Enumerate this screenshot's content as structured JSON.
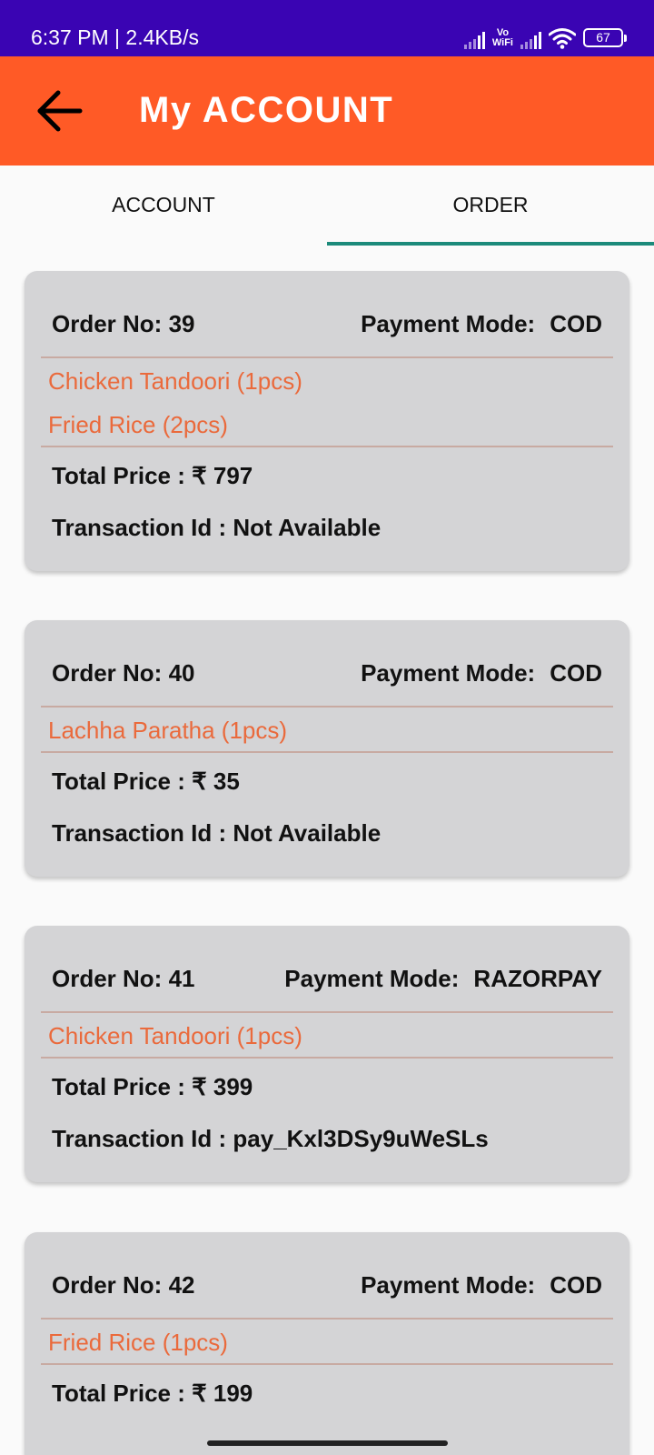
{
  "status_bar": {
    "time_speed": "6:37 PM | 2.4KB/s",
    "vowifi_top": "Vo",
    "vowifi_bottom": "WiFi",
    "battery": "67"
  },
  "app_bar": {
    "title": "My ACCOUNT",
    "back_icon": "arrow-left-icon"
  },
  "tabs": [
    {
      "label": "ACCOUNT",
      "selected": false
    },
    {
      "label": "ORDER",
      "selected": true
    }
  ],
  "labels": {
    "order_no": "Order No:",
    "payment_mode": "Payment Mode:",
    "total_price": "Total Price :",
    "transaction_id": "Transaction Id :"
  },
  "orders": [
    {
      "order_no": "39",
      "payment_mode": "COD",
      "items": [
        "Chicken Tandoori (1pcs)",
        "Fried Rice (2pcs)"
      ],
      "total_price": "₹ 797",
      "transaction_id": "Not Available"
    },
    {
      "order_no": "40",
      "payment_mode": "COD",
      "items": [
        "Lachha Paratha (1pcs)"
      ],
      "total_price": "₹ 35",
      "transaction_id": "Not Available"
    },
    {
      "order_no": "41",
      "payment_mode": "RAZORPAY",
      "items": [
        "Chicken Tandoori (1pcs)"
      ],
      "total_price": "₹ 399",
      "transaction_id": "pay_Kxl3DSy9uWeSLs"
    },
    {
      "order_no": "42",
      "payment_mode": "COD",
      "items": [
        "Fried Rice (1pcs)"
      ],
      "total_price": "₹ 199",
      "transaction_id": ""
    }
  ],
  "colors": {
    "status_bar": "#3a04b3",
    "app_bar": "#ff5a26",
    "tab_indicator": "#1c8a7a",
    "card": "#d4d4d6",
    "item_text": "#ea6a3c"
  }
}
